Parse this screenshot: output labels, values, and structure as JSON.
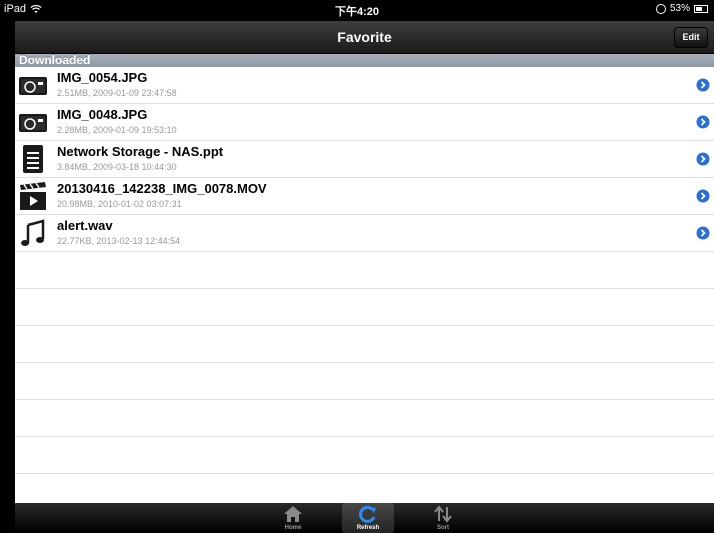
{
  "status": {
    "device": "iPad",
    "time": "下午4:20",
    "battery": "53%"
  },
  "nav": {
    "title": "Favorite",
    "edit_label": "Edit"
  },
  "section": {
    "title": "Downloaded"
  },
  "files": [
    {
      "name": "IMG_0054.JPG",
      "info": "2.51MB, 2009-01-09 23:47:58",
      "icon": "camera-icon"
    },
    {
      "name": "IMG_0048.JPG",
      "info": "2.28MB, 2009-01-09 19:53:10",
      "icon": "camera-icon"
    },
    {
      "name": "Network Storage - NAS.ppt",
      "info": "3.84MB, 2009-03-18 10:44:30",
      "icon": "document-icon"
    },
    {
      "name": "20130416_142238_IMG_0078.MOV",
      "info": "20.98MB, 2010-01-02 03:07:31",
      "icon": "video-icon"
    },
    {
      "name": "alert.wav",
      "info": "22.77KB, 2013-02-13 12:44:54",
      "icon": "music-note-icon"
    }
  ],
  "tabs": [
    {
      "label": "Home",
      "icon": "home-icon"
    },
    {
      "label": "Refresh",
      "icon": "refresh-icon",
      "active": true
    },
    {
      "label": "Sort",
      "icon": "sort-icon"
    }
  ],
  "colors": {
    "accent": "#2a6fd6",
    "section_header": "#96a0ac"
  }
}
